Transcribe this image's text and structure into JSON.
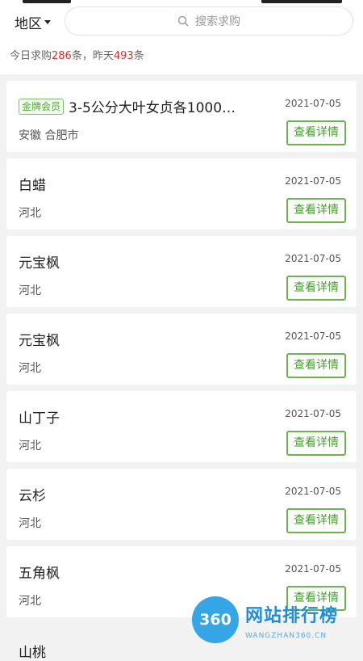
{
  "header": {
    "region_label": "地区",
    "search_placeholder": "搜索求购",
    "stats": {
      "today_prefix": "今日求购",
      "today_count": "286",
      "today_suffix": "条，昨天",
      "yesterday_count": "493",
      "yesterday_suffix": "条"
    }
  },
  "items": [
    {
      "badge": "金牌会员",
      "title": "3-5公分大叶女贞各1000…",
      "date": "2021-07-05",
      "location": "安徽 合肥市",
      "button": "查看详情"
    },
    {
      "title": "白蜡",
      "date": "2021-07-05",
      "location": "河北",
      "button": "查看详情"
    },
    {
      "title": "元宝枫",
      "date": "2021-07-05",
      "location": "河北",
      "button": "查看详情"
    },
    {
      "title": "元宝枫",
      "date": "2021-07-05",
      "location": "河北",
      "button": "查看详情"
    },
    {
      "title": "山丁子",
      "date": "2021-07-05",
      "location": "河北",
      "button": "查看详情"
    },
    {
      "title": "云杉",
      "date": "2021-07-05",
      "location": "河北",
      "button": "查看详情"
    },
    {
      "title": "五角枫",
      "date": "2021-07-05",
      "location": "河北",
      "button": "查看详情"
    }
  ],
  "partial_item_title": "山桃",
  "watermark": {
    "logo_text": "360",
    "name": "网站排行榜",
    "url": "WANGZHAN360.CN"
  },
  "colors": {
    "accent_green": "#6cb251",
    "count_red": "#d9302c",
    "watermark_blue": "#2aa2e5"
  },
  "icons": {
    "search": "search-icon",
    "dropdown": "caret-down-icon"
  }
}
